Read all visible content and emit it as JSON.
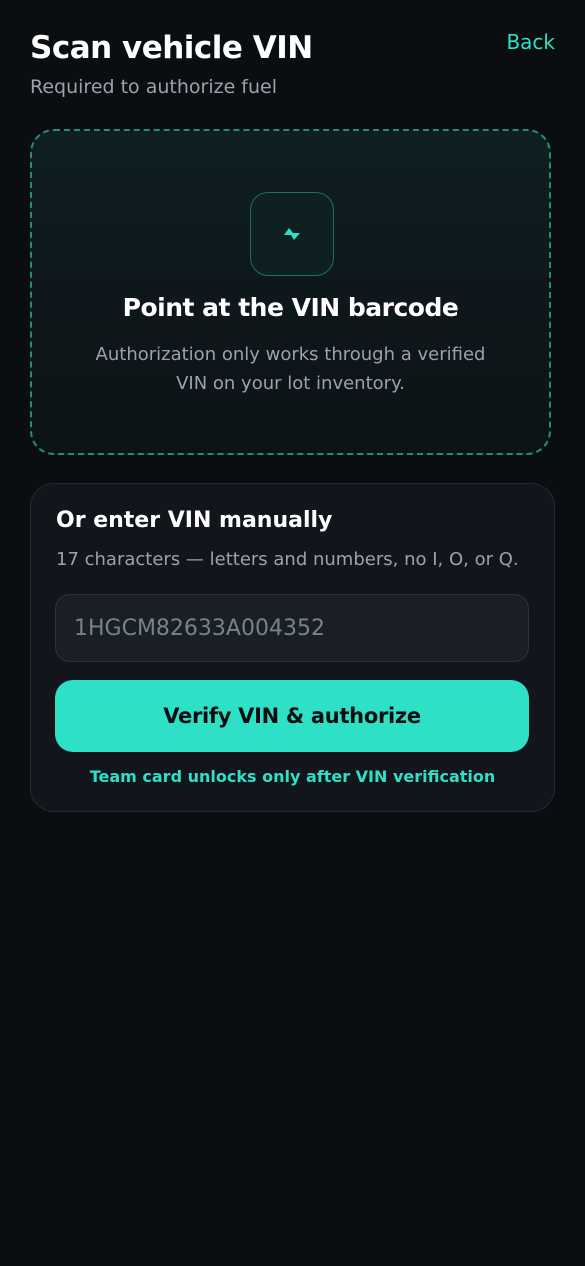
{
  "header": {
    "title": "Scan vehicle VIN",
    "subtitle": "Required to authorize fuel",
    "back_label": "Back"
  },
  "scan": {
    "icon": "bolt-icon",
    "heading": "Point at the VIN barcode",
    "description": "Authorization only works through a verified VIN on your lot inventory."
  },
  "manual": {
    "heading": "Or enter VIN manually",
    "hint": "17 characters — letters and numbers, no I, O, or Q.",
    "input_value": "",
    "input_placeholder": "1HGCM82633A004352",
    "verify_label": "Verify VIN & authorize",
    "note": "Team card unlocks only after VIN verification"
  },
  "colors": {
    "background": "#0a0e11",
    "accent": "#2ee0c6",
    "muted_text": "#9aa3ad",
    "card": "#12161c"
  }
}
